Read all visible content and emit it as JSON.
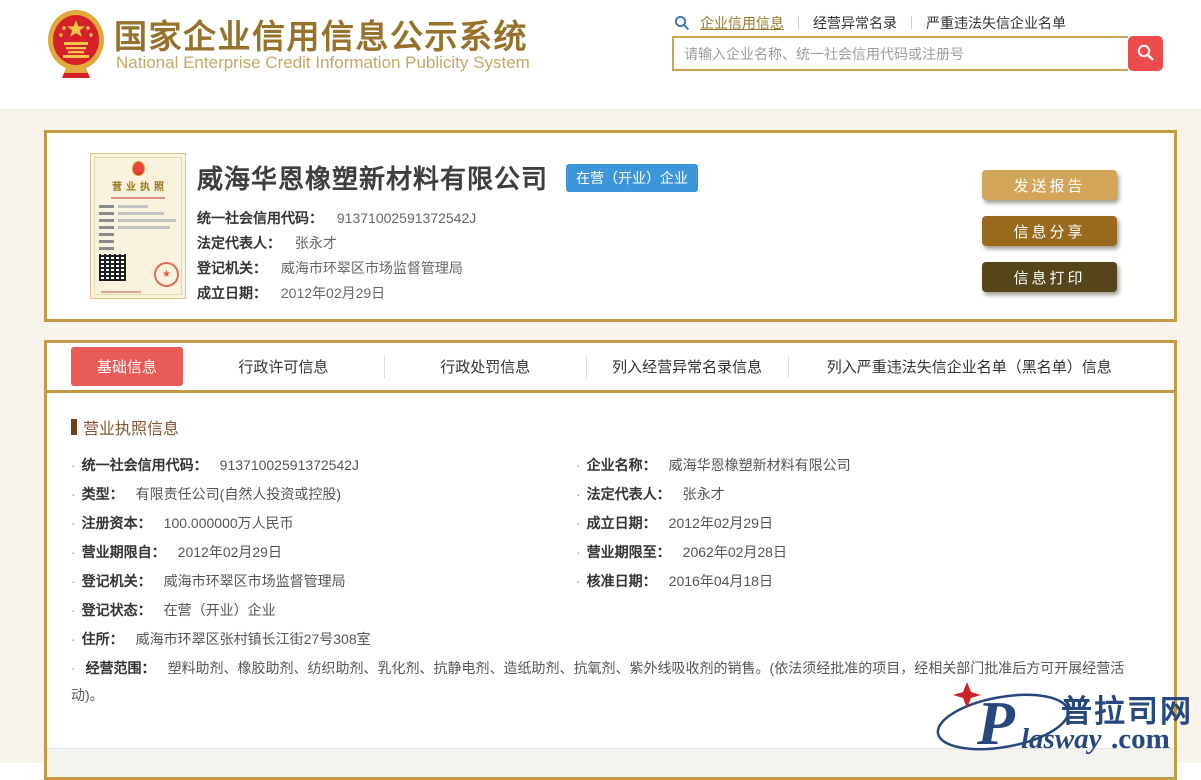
{
  "header": {
    "title": "国家企业信用信息公示系统",
    "subtitle": "National Enterprise Credit Information Publicity System",
    "nav": {
      "link1": "企业信用信息",
      "link2": "经营异常名录",
      "link3": "严重违法失信企业名单"
    },
    "search": {
      "placeholder": "请输入企业名称、统一社会信用代码或注册号",
      "value": ""
    }
  },
  "company": {
    "license_thumb_title": "营业执照",
    "name": "威海华恩橡塑新材料有限公司",
    "status": "在营（开业）企业",
    "fields": [
      {
        "label": "统一社会信用代码：",
        "value": "91371002591372542J"
      },
      {
        "label": "法定代表人：",
        "value": "张永才"
      },
      {
        "label": "登记机关：",
        "value": "威海市环翠区市场监督管理局"
      },
      {
        "label": "成立日期：",
        "value": "2012年02月29日"
      }
    ],
    "buttons": {
      "send": "发送报告",
      "share": "信息分享",
      "print": "信息打印"
    }
  },
  "tabs": {
    "t1": "基础信息",
    "t2": "行政许可信息",
    "t3": "行政处罚信息",
    "t4": "列入经营异常名录信息",
    "t5": "列入严重违法失信企业名单（黑名单）信息"
  },
  "detail": {
    "section_title": "营业执照信息",
    "left_rows": [
      {
        "label": "统一社会信用代码：",
        "value": "91371002591372542J"
      },
      {
        "label": "类型：",
        "value": "有限责任公司(自然人投资或控股)"
      },
      {
        "label": "注册资本：",
        "value": "100.000000万人民币"
      },
      {
        "label": "营业期限自：",
        "value": "2012年02月29日"
      },
      {
        "label": "登记机关：",
        "value": "威海市环翠区市场监督管理局"
      },
      {
        "label": "登记状态：",
        "value": "在营（开业）企业"
      },
      {
        "label": "住所：",
        "value": "威海市环翠区张村镇长江街27号308室"
      }
    ],
    "right_rows": [
      {
        "label": "企业名称：",
        "value": "威海华恩橡塑新材料有限公司"
      },
      {
        "label": "法定代表人：",
        "value": "张永才"
      },
      {
        "label": "成立日期：",
        "value": "2012年02月29日"
      },
      {
        "label": "营业期限至：",
        "value": "2062年02月28日"
      },
      {
        "label": "核准日期：",
        "value": "2016年04月18日"
      }
    ],
    "scope": {
      "label": "经营范围：",
      "value": "塑料助剂、橡胶助剂、纺织助剂、乳化剂、抗静电剂、造纸助剂、抗氧剂、紫外线吸收剂的销售。(依法须经批准的项目，经相关部门批准后方可开展经营活动)。"
    }
  },
  "watermark": {
    "cn": "普拉司网",
    "p": "P",
    "rest": "lasway",
    "dot": ".com"
  },
  "colors": {
    "gold_border": "#C49B40",
    "title_gold": "#96722A",
    "accent_red": "#E85B57",
    "search_red": "#EE4C4C",
    "badge_blue": "#3E96DA",
    "btn_tan": "#D2A558",
    "btn_brown": "#99691E",
    "btn_dark": "#564518"
  }
}
